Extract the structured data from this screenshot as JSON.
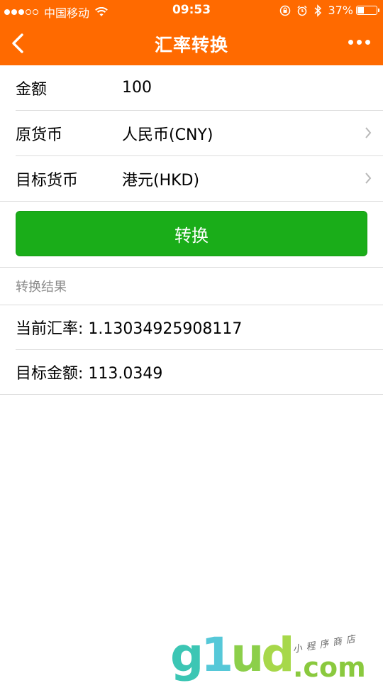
{
  "status_bar": {
    "carrier": "中国移动",
    "time": "09:53",
    "battery": "37%",
    "battery_level": 0.37
  },
  "nav": {
    "title": "汇率转换"
  },
  "form": {
    "amount": {
      "label": "金额",
      "value": "100"
    },
    "source_currency": {
      "label": "原货币",
      "value": "人民币(CNY)"
    },
    "target_currency": {
      "label": "目标货币",
      "value": "港元(HKD)"
    }
  },
  "convert_button": {
    "label": "转换"
  },
  "result": {
    "header": "转换结果",
    "rate": "当前汇率: 1.13034925908117",
    "target_amount": "目标金额: 113.0349"
  },
  "watermark": {
    "logo_g": "g",
    "logo_1": "1",
    "logo_u": "u",
    "logo_d": "d",
    "domain": ".com",
    "tagline": "小程序商店"
  },
  "colors": {
    "brand_orange": "#ff6a00",
    "button_green": "#1aad19"
  }
}
